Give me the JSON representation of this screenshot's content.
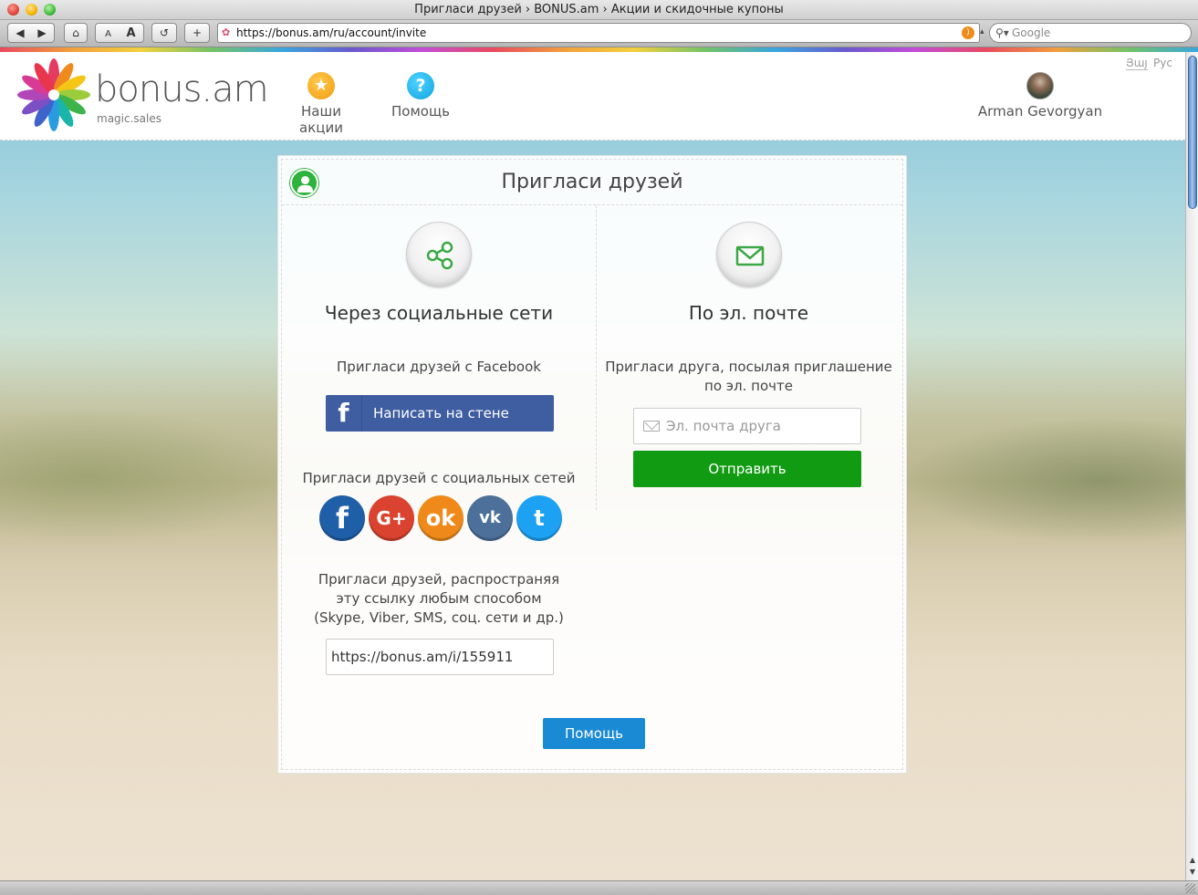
{
  "window": {
    "title": "Пригласи друзей › BONUS.am › Акции и скидочные купоны",
    "url": "https://bonus.am/ru/account/invite",
    "search_placeholder": "Google",
    "toolbar": {
      "back": "◀",
      "forward": "▶",
      "home": "⌂",
      "font_small": "A",
      "font_large": "A",
      "reload": "↺",
      "add": "+"
    }
  },
  "site": {
    "logo_text": "bonus.am",
    "logo_tagline": "magic.sales",
    "nav": {
      "actions_icon": "★",
      "actions_label": "Наши акции",
      "help_icon": "?",
      "help_label": "Помощь"
    },
    "user": {
      "name": "Arman Gevorgyan"
    },
    "languages": [
      "Յայ",
      "Рус"
    ]
  },
  "invite": {
    "title": "Пригласи друзей",
    "social": {
      "heading": "Через социальные сети",
      "facebook_text": "Пригласи друзей с Facebook",
      "facebook_glyph": "f",
      "facebook_button": "Написать на стене",
      "networks_text": "Пригласи друзей с социальных сетей",
      "networks": [
        {
          "name": "facebook",
          "glyph": "f",
          "color": "#1f5fa8"
        },
        {
          "name": "google-plus",
          "glyph": "G+",
          "color": "#d9432f"
        },
        {
          "name": "odnoklassniki",
          "glyph": "ok",
          "color": "#ef8a1a"
        },
        {
          "name": "vkontakte",
          "glyph": "vk",
          "color": "#4c7099"
        },
        {
          "name": "twitter",
          "glyph": "t",
          "color": "#1da1f2"
        }
      ],
      "link_text": "Пригласи друзей, распространяя эту ссылку любым способом (Skype, Viber, SMS, соц. сети и др.)",
      "link_value": "https://bonus.am/i/155911"
    },
    "email": {
      "heading": "По эл. почте",
      "text": "Пригласи друга, посылая приглашение по эл. почте",
      "placeholder": "Эл. почта друга",
      "send_button": "Отправить"
    },
    "help_button": "Помощь"
  },
  "colors": {
    "accent_green": "#119b12",
    "facebook_blue": "#3f5ea1",
    "help_blue": "#1b8ad4",
    "profile_icon": "#2eb43c"
  },
  "icons": [
    "star-icon",
    "question-icon",
    "user-icon",
    "share-icon",
    "envelope-icon",
    "facebook-icon",
    "google-plus-icon",
    "odnoklassniki-icon",
    "vk-icon",
    "twitter-icon"
  ]
}
